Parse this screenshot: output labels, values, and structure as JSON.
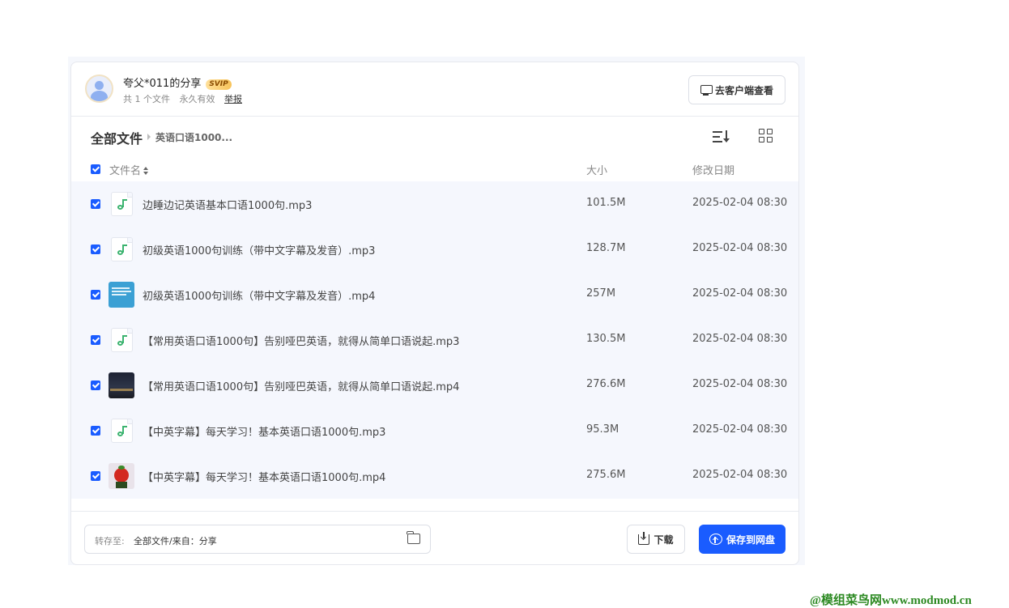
{
  "share": {
    "title": "夸父*011的分享",
    "vip_badge": "SVIP",
    "file_count": "共 1 个文件",
    "validity": "永久有效",
    "report_link": "举报",
    "client_button": "去客户端查看"
  },
  "breadcrumb": {
    "root": "全部文件",
    "current": "英语口语1000..."
  },
  "columns": {
    "name": "文件名",
    "size": "大小",
    "modified": "修改日期"
  },
  "files": [
    {
      "name": "边睡边记英语基本口语1000句.mp3",
      "size": "101.5M",
      "date": "2025-02-04 08:30",
      "type": "mp3-icon"
    },
    {
      "name": "初级英语1000句训练（带中文字幕及发音）.mp3",
      "size": "128.7M",
      "date": "2025-02-04 08:30",
      "type": "mp3-icon"
    },
    {
      "name": "初级英语1000句训练（带中文字幕及发音）.mp4",
      "size": "257M",
      "date": "2025-02-04 08:30",
      "type": "video-thumbnail"
    },
    {
      "name": "【常用英语口语1000句】告别哑巴英语，就得从简单口语说起.mp3",
      "size": "130.5M",
      "date": "2025-02-04 08:30",
      "type": "mp3-icon"
    },
    {
      "name": "【常用英语口语1000句】告别哑巴英语，就得从简单口语说起.mp4",
      "size": "276.6M",
      "date": "2025-02-04 08:30",
      "type": "video-thumbnail"
    },
    {
      "name": "【中英字幕】每天学习！基本英语口语1000句.mp3",
      "size": "95.3M",
      "date": "2025-02-04 08:30",
      "type": "mp3-icon"
    },
    {
      "name": "【中英字幕】每天学习！基本英语口语1000句.mp4",
      "size": "275.6M",
      "date": "2025-02-04 08:30",
      "type": "video-thumbnail"
    }
  ],
  "footer": {
    "save_to_label": "转存至:",
    "save_to_path": "全部文件/来自：分享",
    "download_button": "下载",
    "save_button": "保存到网盘"
  },
  "watermark": "@模组菜鸟网www.modmod.cn",
  "colors": {
    "accent": "#1a5cff",
    "row_bg": "#f5f7fd",
    "audio_icon": "#3bb36f"
  }
}
